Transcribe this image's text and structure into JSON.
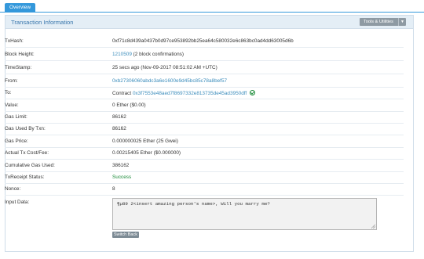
{
  "tabs": {
    "overview_label": "Overview"
  },
  "panel": {
    "title": "Transaction Information",
    "tools_label": "Tools & Utilities"
  },
  "fields": {
    "txhash": {
      "label": "TxHash:",
      "value": "0xf71c8d439a0437b0d97ce953892bb25ea64c580032e6c863bc0ad4dd63005d6b"
    },
    "block_height": {
      "label": "Block Height:",
      "block": "1210509",
      "confirmations": "(2 block confirmations)"
    },
    "timestamp": {
      "label": "TimeStamp:",
      "value": "25 secs ago (Nov-09-2017 08:51:02 AM +UTC)"
    },
    "from": {
      "label": "From:",
      "value": "0xb27306060abdc3a6e1600e9d45bc85c78a8bef57"
    },
    "to": {
      "label": "To:",
      "prefix": "Contract",
      "address": "0x3f7553e48aed7f8697332e813735de45ad3950dff"
    },
    "value": {
      "label": "Value:",
      "value": "0 Ether ($0.00)"
    },
    "gas_limit": {
      "label": "Gas Limit:",
      "value": "86162"
    },
    "gas_used": {
      "label": "Gas Used By Txn:",
      "value": "86162"
    },
    "gas_price": {
      "label": "Gas Price:",
      "value": "0.000000025 Ether (25 Gwei)"
    },
    "tx_cost": {
      "label": "Actual Tx Cost/Fee:",
      "value": "0.00215405 Ether ($0.000000)"
    },
    "cumulative_gas": {
      "label": "Cumulative Gas Used:",
      "value": "386162"
    },
    "receipt_status": {
      "label": "TxReceipt Status:",
      "value": "Success"
    },
    "nonce": {
      "label": "Nonce:",
      "value": "8"
    },
    "input_data": {
      "label": "Input Data:",
      "value": "¶µ89 2<insert amazing person's name>, Will you marry me?"
    }
  },
  "buttons": {
    "switch_back": "Switch Back"
  },
  "colors": {
    "accent": "#3498db",
    "link": "#3c8dbc",
    "success": "#1c8b3a",
    "header_bg": "#e4eef6"
  },
  "icons": {
    "verified": "check-circle-icon",
    "caret": "caret-down-icon",
    "resize": "resize-grip-icon"
  }
}
